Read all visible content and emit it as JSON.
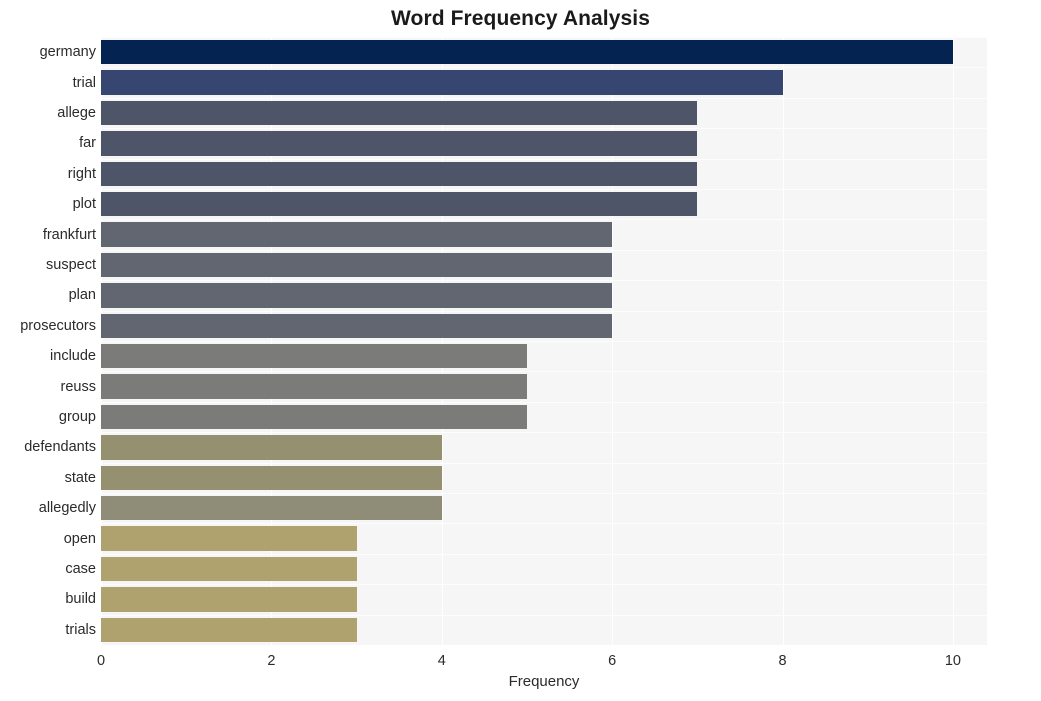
{
  "chart_data": {
    "type": "bar",
    "orientation": "horizontal",
    "title": "Word Frequency Analysis",
    "xlabel": "Frequency",
    "ylabel": "",
    "xlim": [
      0,
      10.4
    ],
    "ylim": [
      0,
      20
    ],
    "grid": true,
    "legend": null,
    "x_ticks": [
      0,
      2,
      4,
      6,
      8,
      10
    ],
    "x_tick_labels": [
      "0",
      "2",
      "4",
      "6",
      "8",
      "10"
    ],
    "categories": [
      "germany",
      "trial",
      "allege",
      "far",
      "right",
      "plot",
      "frankfurt",
      "suspect",
      "plan",
      "prosecutors",
      "include",
      "reuss",
      "group",
      "defendants",
      "state",
      "allegedly",
      "open",
      "case",
      "build",
      "trials"
    ],
    "values": [
      10,
      8,
      7,
      7,
      7,
      7,
      6,
      6,
      6,
      6,
      5,
      5,
      5,
      4,
      4,
      4,
      3,
      3,
      3,
      3
    ],
    "bar_colors": [
      "#042350",
      "#364670",
      "#4e5568",
      "#4e5568",
      "#4e5568",
      "#4e5568",
      "#626670",
      "#626670",
      "#626670",
      "#626670",
      "#7b7b79",
      "#7b7b79",
      "#7b7b79",
      "#95906f",
      "#95906f",
      "#8f8c78",
      "#afa26f",
      "#afa26f",
      "#afa26f",
      "#afa26f"
    ],
    "plot_background": "#f6f6f7",
    "figure_background": "#ffffff",
    "gridline_color": "#ffffff",
    "title_color": "#1a1a1a",
    "tick_color": "#2b2b2b"
  }
}
